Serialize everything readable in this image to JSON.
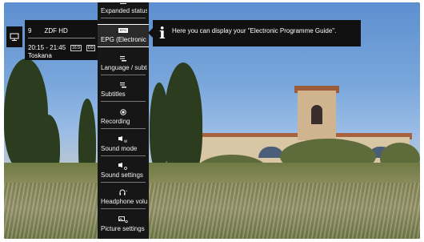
{
  "channel": {
    "number": "9",
    "name": "ZDF HD",
    "time": "20:15 - 21:45",
    "badges": [
      "16:9",
      "DD"
    ],
    "programme": "Toskana"
  },
  "menu": {
    "items": [
      {
        "label": "Expanded status",
        "icon": "expanded-status-icon"
      },
      {
        "label": "EPG (Electronic Programme Guide)",
        "icon": "epg-icon",
        "icon_text": "EPG",
        "selected": true
      },
      {
        "label": "Language / subtitles",
        "icon": "language-icon"
      },
      {
        "label": "Subtitles",
        "icon": "subtitles-icon"
      },
      {
        "label": "Recording",
        "icon": "recording-icon"
      },
      {
        "label": "Sound mode",
        "icon": "sound-mode-icon"
      },
      {
        "label": "Sound settings",
        "icon": "sound-settings-icon"
      },
      {
        "label": "Headphone volume",
        "icon": "headphone-icon"
      },
      {
        "label": "Picture settings",
        "icon": "picture-settings-icon"
      }
    ]
  },
  "info": {
    "icon_glyph": "i",
    "text": "Here you can display your \"Electronic Programme Guide\"."
  }
}
